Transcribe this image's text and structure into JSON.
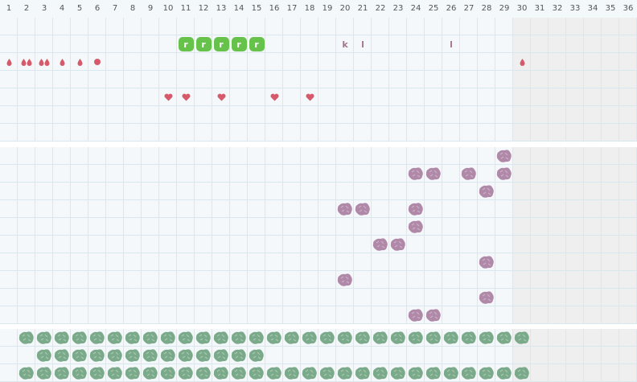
{
  "columns": [
    "1",
    "2",
    "3",
    "4",
    "5",
    "6",
    "7",
    "8",
    "9",
    "10",
    "11",
    "12",
    "13",
    "14",
    "15",
    "16",
    "17",
    "18",
    "19",
    "20",
    "21",
    "22",
    "23",
    "24",
    "25",
    "26",
    "27",
    "28",
    "29",
    "30",
    "31",
    "32",
    "33",
    "34",
    "35",
    "36"
  ],
  "colors": {
    "header_bg": "#f3f8fb",
    "cell_bg": "#f4f8fb",
    "cell_bg_shaded": "#efefef",
    "grid_line": "#d8e8ee",
    "section_gap": "#ffffff",
    "green_tile": "#66c24a",
    "red_mark": "#d65a6a",
    "letter_mark": "#a7748f",
    "purple_blob": "#b088a8",
    "teal_blob": "#7aaa8a"
  },
  "shaded_from_column": 30,
  "tracks": [
    {
      "rows": 7,
      "marks": [
        {
          "row": 1,
          "col": 11,
          "kind": "green-tile-icon",
          "text": "r"
        },
        {
          "row": 1,
          "col": 12,
          "kind": "green-tile-icon",
          "text": "r"
        },
        {
          "row": 1,
          "col": 13,
          "kind": "green-tile-icon",
          "text": "r"
        },
        {
          "row": 1,
          "col": 14,
          "kind": "green-tile-icon",
          "text": "r"
        },
        {
          "row": 1,
          "col": 15,
          "kind": "green-tile-icon",
          "text": "r"
        },
        {
          "row": 1,
          "col": 20,
          "kind": "letter",
          "text": "k"
        },
        {
          "row": 1,
          "col": 21,
          "kind": "letter",
          "text": "l"
        },
        {
          "row": 1,
          "col": 26,
          "kind": "letter",
          "text": "l"
        },
        {
          "row": 2,
          "col": 1,
          "kind": "drop-icon",
          "count": 1
        },
        {
          "row": 2,
          "col": 2,
          "kind": "drop-icon",
          "count": 2
        },
        {
          "row": 2,
          "col": 3,
          "kind": "drop-icon",
          "count": 2
        },
        {
          "row": 2,
          "col": 4,
          "kind": "drop-icon",
          "count": 1
        },
        {
          "row": 2,
          "col": 5,
          "kind": "drop-icon",
          "count": 1
        },
        {
          "row": 2,
          "col": 6,
          "kind": "dot-icon"
        },
        {
          "row": 2,
          "col": 30,
          "kind": "drop-icon",
          "count": 1
        },
        {
          "row": 4,
          "col": 10,
          "kind": "heart-icon"
        },
        {
          "row": 4,
          "col": 11,
          "kind": "heart-icon"
        },
        {
          "row": 4,
          "col": 13,
          "kind": "heart-icon"
        },
        {
          "row": 4,
          "col": 16,
          "kind": "heart-icon"
        },
        {
          "row": 4,
          "col": 18,
          "kind": "heart-icon"
        }
      ]
    },
    {
      "rows": 10,
      "marks": [
        {
          "row": 0,
          "col": 29,
          "kind": "purple-blob-icon"
        },
        {
          "row": 1,
          "col": 24,
          "kind": "purple-blob-icon"
        },
        {
          "row": 1,
          "col": 25,
          "kind": "purple-blob-icon"
        },
        {
          "row": 1,
          "col": 27,
          "kind": "purple-blob-icon"
        },
        {
          "row": 1,
          "col": 29,
          "kind": "purple-blob-icon"
        },
        {
          "row": 2,
          "col": 28,
          "kind": "purple-blob-icon"
        },
        {
          "row": 3,
          "col": 20,
          "kind": "purple-blob-icon"
        },
        {
          "row": 3,
          "col": 21,
          "kind": "purple-blob-icon"
        },
        {
          "row": 3,
          "col": 24,
          "kind": "purple-blob-icon"
        },
        {
          "row": 4,
          "col": 24,
          "kind": "purple-blob-icon"
        },
        {
          "row": 5,
          "col": 22,
          "kind": "purple-blob-icon"
        },
        {
          "row": 5,
          "col": 23,
          "kind": "purple-blob-icon"
        },
        {
          "row": 6,
          "col": 28,
          "kind": "purple-blob-icon"
        },
        {
          "row": 7,
          "col": 20,
          "kind": "purple-blob-icon"
        },
        {
          "row": 8,
          "col": 28,
          "kind": "purple-blob-icon"
        },
        {
          "row": 9,
          "col": 24,
          "kind": "purple-blob-icon"
        },
        {
          "row": 9,
          "col": 25,
          "kind": "purple-blob-icon"
        }
      ]
    },
    {
      "rows": 3,
      "marks": [],
      "blob_rows": [
        {
          "row": 0,
          "from": 2,
          "to": 30
        },
        {
          "row": 1,
          "from": 3,
          "to": 15
        },
        {
          "row": 2,
          "from": 2,
          "to": 30
        }
      ]
    }
  ]
}
